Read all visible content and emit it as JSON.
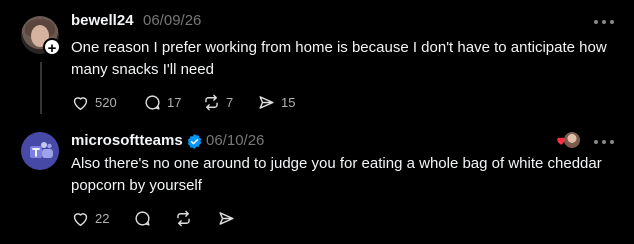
{
  "posts": [
    {
      "username": "bewell24",
      "date": "06/09/26",
      "text": "One reason I prefer working from home is because I don't have to anticipate how many snacks I'll need",
      "likes": "520",
      "replies": "17",
      "reposts": "7",
      "shares": "15",
      "avatar_icon": "user-avatar",
      "badge_icon": "follow-plus-icon"
    },
    {
      "username": "microsoftteams",
      "date": "06/10/26",
      "text": "Also there's no one around to judge you for eating a whole bag of white cheddar popcorn by yourself",
      "likes": "22",
      "verified": true,
      "avatar_icon": "microsoft-teams-logo",
      "liked_by_author": true
    }
  ],
  "colors": {
    "background": "#000000",
    "text": "#f3f5f7",
    "muted": "#777777",
    "verified": "#0095f6",
    "heart": "#ff3040"
  }
}
